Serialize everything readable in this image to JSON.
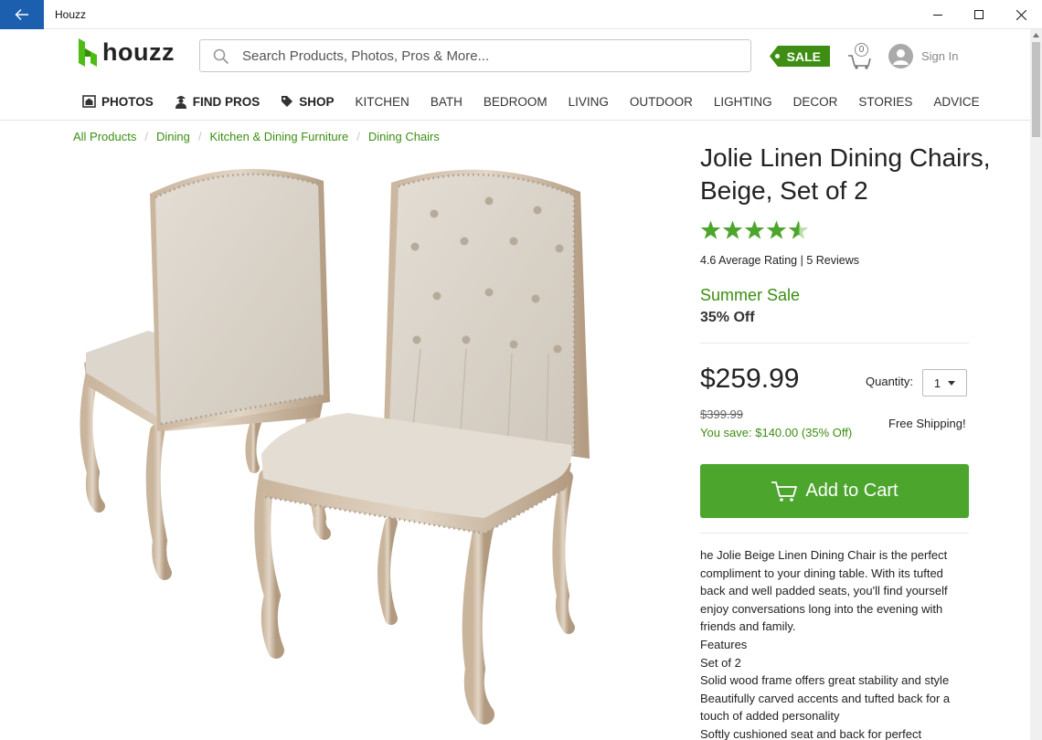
{
  "window": {
    "title": "Houzz"
  },
  "header": {
    "logo_text": "houzz",
    "search_placeholder": "Search Products, Photos, Pros & More...",
    "sale_label": "SALE",
    "cart_count": "0",
    "signin_label": "Sign In"
  },
  "nav": {
    "items": [
      "PHOTOS",
      "FIND PROS",
      "SHOP",
      "KITCHEN",
      "BATH",
      "BEDROOM",
      "LIVING",
      "OUTDOOR",
      "LIGHTING",
      "DECOR",
      "STORIES",
      "ADVICE"
    ]
  },
  "breadcrumb": [
    "All Products",
    "Dining",
    "Kitchen & Dining Furniture",
    "Dining Chairs"
  ],
  "product": {
    "title": "Jolie Linen Dining Chairs, Beige, Set of 2",
    "rating_value": 4.6,
    "rating_text": "4.6 Average Rating",
    "rating_sep": " | ",
    "reviews_text": "5 Reviews",
    "sale_title": "Summer Sale",
    "sale_off": "35% Off",
    "price": "$259.99",
    "quantity_label": "Quantity:",
    "quantity_value": "1",
    "original_price": "$399.99",
    "you_save": "You save: $140.00 (35% Off)",
    "shipping": "Free Shipping!",
    "cart_button": "Add to Cart",
    "description": [
      "he Jolie Beige Linen Dining Chair is the perfect compliment to your dining table. With its tufted back and well padded seats, you'll find yourself enjoy conversations long into the evening with friends and family.",
      "Features",
      "Set of 2",
      "Solid wood frame offers great stability and style",
      "Beautifully carved accents and tufted back for a touch of added personality",
      "Softly cushioned seat and back for perfect"
    ]
  },
  "colors": {
    "brand_green": "#3d8e12",
    "button_green": "#4ca52d",
    "titlebar_blue": "#1b5fae"
  }
}
